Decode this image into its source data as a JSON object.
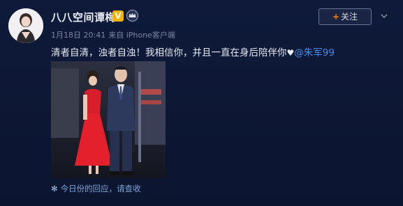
{
  "post": {
    "username": "八八空间谭梅",
    "verified_badge": "V",
    "follow_label": "关注",
    "follow_plus": "+",
    "time": "1月18日 20:41",
    "source": "来自 iPhone客户端",
    "text_main": "清者自清，浊者自浊！我相信你，并且一直在身后陪伴你",
    "heart": "♥",
    "mention": "@朱军99",
    "reply_hint": "今日份的回应，请查收",
    "reply_icon": "✻"
  },
  "colors": {
    "background": "#0b1530",
    "mention": "#4a8ee9",
    "follow_plus": "#ff8200",
    "badge": "#f3b300"
  }
}
